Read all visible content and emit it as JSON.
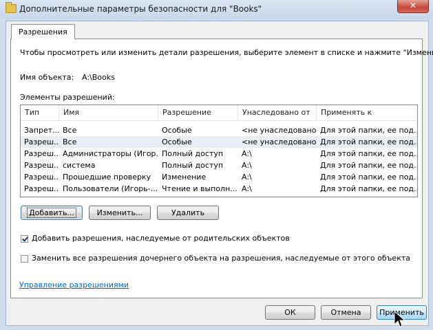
{
  "window": {
    "title": "Дополнительные параметры безопасности  для \"Books\"",
    "close_label": "✕"
  },
  "tab": {
    "label": "Разрешения"
  },
  "panel": {
    "instruction": "Чтобы просмотреть или изменить детали разрешения, выберите элемент в списке и нажмите \"Изменить\".",
    "object_name_label": "Имя объекта:",
    "object_name_value": "A:\\Books",
    "entries_label": "Элементы разрешений:"
  },
  "columns": [
    "Тип",
    "Имя",
    "Разрешение",
    "Унаследовано от",
    "Применять к"
  ],
  "rows": [
    [
      "Запрет...",
      "Все",
      "Особые",
      "<не унаследовано>",
      "Для этой папки, ее под..."
    ],
    [
      "Разреш...",
      "Все",
      "Особые",
      "<не унаследовано>",
      "Для этой папки, ее под..."
    ],
    [
      "Разреш...",
      "Администраторы (Игор...",
      "Полный доступ",
      "A:\\",
      "Для этой папки, ее под..."
    ],
    [
      "Разреш...",
      "система",
      "Полный доступ",
      "A:\\",
      "Для этой папки, ее под..."
    ],
    [
      "Разреш...",
      "Прошедшие проверку",
      "Изменение",
      "A:\\",
      "Для этой папки, ее под..."
    ],
    [
      "Разреш...",
      "Пользователи (Игорь-...",
      "Чтение и выполн...",
      "A:\\",
      "Для этой папки, ее под..."
    ]
  ],
  "buttons": {
    "add": "Добавить...",
    "change": "Изменить...",
    "remove": "Удалить",
    "ok": "ОК",
    "cancel": "Отмена",
    "apply": "Применить"
  },
  "checkboxes": {
    "inherit_label": "Добавить разрешения, наследуемые от родительских объектов",
    "inherit_checked": true,
    "replace_label": "Заменить все разрешения дочернего объекта на разрешения, наследуемые от этого объекта",
    "replace_checked": false
  },
  "link": {
    "manage": "Управление разрешениями"
  }
}
